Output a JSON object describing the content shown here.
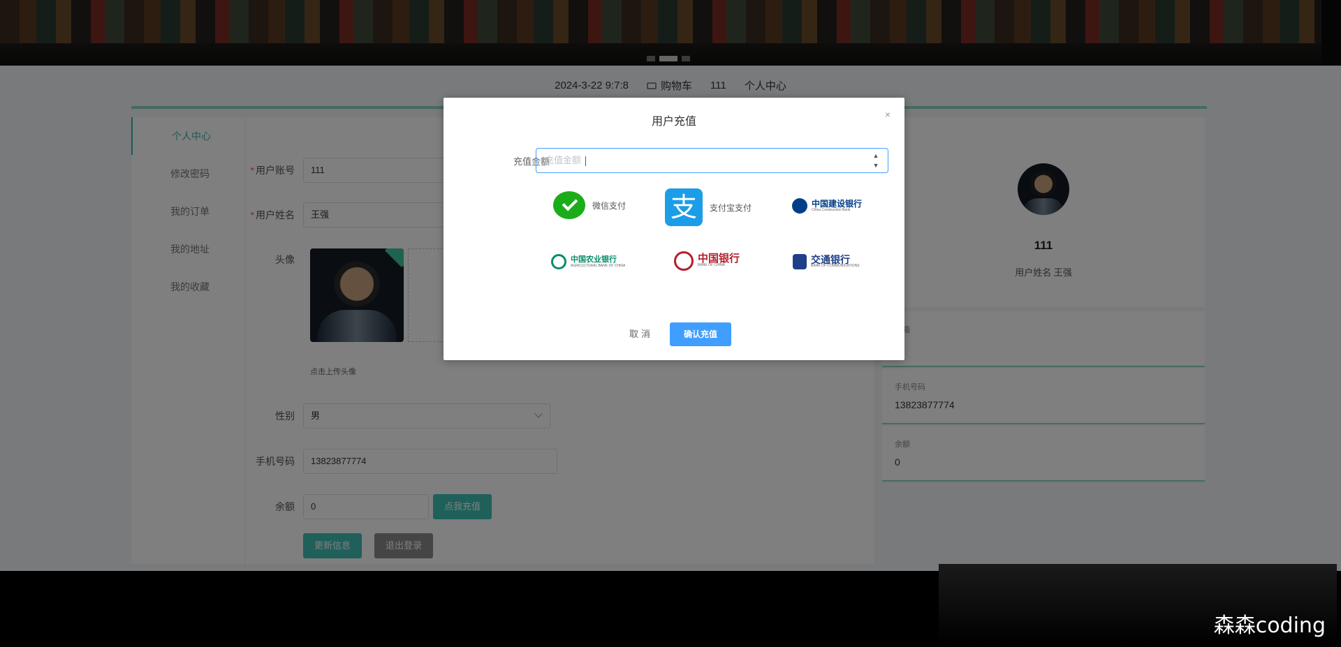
{
  "topbar": {
    "datetime": "2024-3-22 9:7:8",
    "cart_label": "购物车",
    "user_id": "111",
    "center_label": "个人中心"
  },
  "sidebar": {
    "items": [
      {
        "label": "个人中心"
      },
      {
        "label": "修改密码"
      },
      {
        "label": "我的订单"
      },
      {
        "label": "我的地址"
      },
      {
        "label": "我的收藏"
      }
    ]
  },
  "form": {
    "account_label": "用户账号",
    "account_value": "111",
    "name_label": "用户姓名",
    "name_value": "王强",
    "avatar_label": "头像",
    "upload_hint": "点击上传头像",
    "gender_label": "性别",
    "gender_value": "男",
    "phone_label": "手机号码",
    "phone_value": "13823877774",
    "balance_label": "余额",
    "balance_value": "0",
    "recharge_button": "点我充值",
    "update_button": "更新信息",
    "logout_button": "退出登录"
  },
  "profile": {
    "user_id": "111",
    "name_text": "用户姓名 王强",
    "cards": [
      {
        "key": "邮箱",
        "value": ""
      },
      {
        "key": "手机号码",
        "value": "13823877774"
      },
      {
        "key": "余额",
        "value": "0"
      }
    ]
  },
  "modal": {
    "title": "用户充值",
    "close": "×",
    "amount_label": "充值金额",
    "amount_placeholder": "充值金额",
    "payments": [
      {
        "name": "微信支付",
        "icon": "wechat-pay-icon"
      },
      {
        "name": "支付宝支付",
        "icon": "alipay-icon"
      },
      {
        "name": "中国建设银行",
        "sub": "China Construction Bank",
        "icon": "ccb-logo"
      },
      {
        "name": "中国农业银行",
        "sub": "AGRICULTURAL BANK OF CHINA",
        "icon": "abc-logo"
      },
      {
        "name": "中国银行",
        "sub": "BANK OF CHINA",
        "icon": "boc-logo"
      },
      {
        "name": "交通银行",
        "sub": "BANK OF COMMUNICATIONS",
        "icon": "bocom-logo"
      }
    ],
    "cancel": "取消",
    "confirm": "确认充值"
  },
  "watermark": "森森coding",
  "colors": {
    "accent": "#3ec1b5",
    "primary": "#409eff",
    "wechat": "#1aad19",
    "alipay": "#1c9de8"
  }
}
